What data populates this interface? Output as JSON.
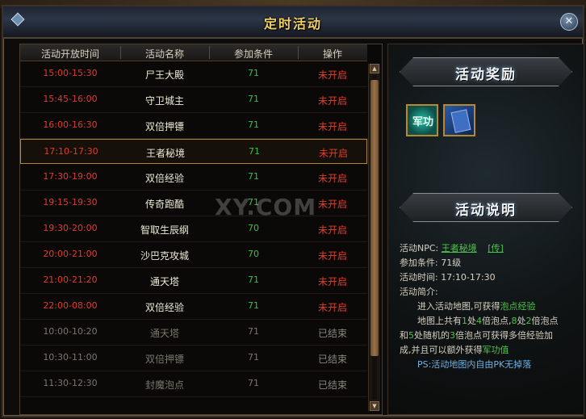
{
  "window": {
    "title": "定时活动"
  },
  "table": {
    "headers": [
      "活动开放时间",
      "活动名称",
      "参加条件",
      "操作"
    ],
    "rows": [
      {
        "time": "15:00-15:30",
        "name": "尸王大殿",
        "cond": "71",
        "op": "未开启",
        "state": "pending"
      },
      {
        "time": "15:45-16:00",
        "name": "守卫城主",
        "cond": "71",
        "op": "未开启",
        "state": "pending"
      },
      {
        "time": "16:00-16:30",
        "name": "双倍押镖",
        "cond": "71",
        "op": "未开启",
        "state": "pending"
      },
      {
        "time": "17:10-17:30",
        "name": "王者秘境",
        "cond": "71",
        "op": "未开启",
        "state": "selected"
      },
      {
        "time": "17:30-19:00",
        "name": "双倍经验",
        "cond": "71",
        "op": "未开启",
        "state": "pending"
      },
      {
        "time": "19:15-19:30",
        "name": "传奇跑酷",
        "cond": "71",
        "op": "未开启",
        "state": "pending"
      },
      {
        "time": "19:30-20:00",
        "name": "智取生辰纲",
        "cond": "70",
        "op": "未开启",
        "state": "pending"
      },
      {
        "time": "20:00-21:00",
        "name": "沙巴克攻城",
        "cond": "70",
        "op": "未开启",
        "state": "pending"
      },
      {
        "time": "21:00-21:20",
        "name": "通天塔",
        "cond": "71",
        "op": "未开启",
        "state": "pending"
      },
      {
        "time": "22:00-08:00",
        "name": "双倍经验",
        "cond": "71",
        "op": "未开启",
        "state": "pending"
      },
      {
        "time": "10:00-10:20",
        "name": "通天塔",
        "cond": "71",
        "op": "已结束",
        "state": "ended"
      },
      {
        "time": "10:30-11:00",
        "name": "双倍押镖",
        "cond": "71",
        "op": "已结束",
        "state": "ended"
      },
      {
        "time": "11:30-12:30",
        "name": "封魔泡点",
        "cond": "71",
        "op": "已结束",
        "state": "ended"
      }
    ]
  },
  "rewards": {
    "heading": "活动奖励",
    "items": [
      {
        "icon": "medal-icon",
        "label": "军功"
      },
      {
        "icon": "skill-book-icon"
      }
    ]
  },
  "info": {
    "heading": "活动说明",
    "npc_label": "活动NPC:",
    "npc_name": "王者秘境",
    "npc_action": "[传]",
    "cond_line": "参加条件: 71级",
    "time_line": "活动时间: 17:10-17:30",
    "intro_label": "活动简介:",
    "p1_a": "进入活动地图,可获得",
    "p1_b": "泡点经验",
    "p2_a": "地图上共有",
    "p2_b": "1",
    "p2_c": "处",
    "p2_d": "4",
    "p2_e": "倍泡点,",
    "p2_f": "8",
    "p2_g": "处",
    "p2_h": "2",
    "p2_i": "倍泡点",
    "p3_a": "和",
    "p3_b": "5",
    "p3_c": "处随机的",
    "p3_d": "3",
    "p3_e": "倍泡点可获得多倍经验加",
    "p4_a": "成,并且可以额外获得",
    "p4_b": "军功值",
    "note": "PS:活动地图内自由PK无掉落"
  },
  "watermark": "XY.COM",
  "colors": {
    "pending_time": "#e03b2c",
    "condition": "#3fc23a",
    "ended": "#7c766c",
    "selected_border": "#b3872f",
    "title": "#f0d060"
  }
}
